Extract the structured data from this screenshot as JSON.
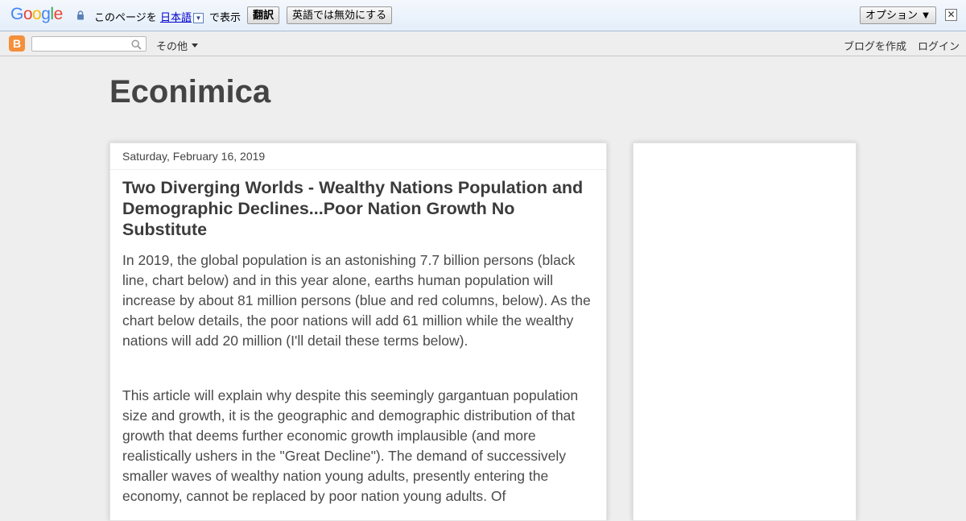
{
  "translate_bar": {
    "logo": {
      "g1": "G",
      "o1": "o",
      "o2": "o",
      "g2": "g",
      "l": "l",
      "e": "e"
    },
    "prefix_text": "このページを",
    "language_link": "日本語",
    "language_dropdown": "▼",
    "suffix_text": "で表示",
    "translate_button": "翻訳",
    "disable_button": "英語では無効にする",
    "options_button": "オプション ▼",
    "close_glyph": "✕"
  },
  "navbar": {
    "logo_glyph": "B",
    "search": {
      "value": "",
      "placeholder": ""
    },
    "more_label": "その他",
    "create_blog": "ブログを作成",
    "login": "ログイン"
  },
  "blog": {
    "title": "Econimica"
  },
  "post": {
    "date": "Saturday, February 16, 2019",
    "title": "Two Diverging Worlds - Wealthy Nations Population and Demographic Declines...Poor Nation Growth No Substitute",
    "paragraphs": [
      "In 2019, the global population is an astonishing 7.7 billion persons (black line, chart below) and in this year alone, earths human population will increase by about 81 million persons (blue and red columns, below).  As the chart below details, the poor nations will add 61 million while the wealthy nations will add 20 million (I'll detail these terms below).",
      "This article will explain why despite this seemingly gargantuan population size and growth, it is the geographic and demographic distribution of that growth that deems further economic growth implausible (and more realistically ushers in the \"Great Decline\").  The demand of successively smaller waves of wealthy nation young adults, presently entering the economy, cannot be replaced by poor nation young adults.  Of"
    ]
  },
  "colors": {
    "page_bg": "#eeeeee",
    "card_bg": "#ffffff",
    "title_text": "#444444",
    "body_text": "#4a4a4a",
    "link": "#0000cc",
    "blogger_orange": "#f58f3b"
  }
}
